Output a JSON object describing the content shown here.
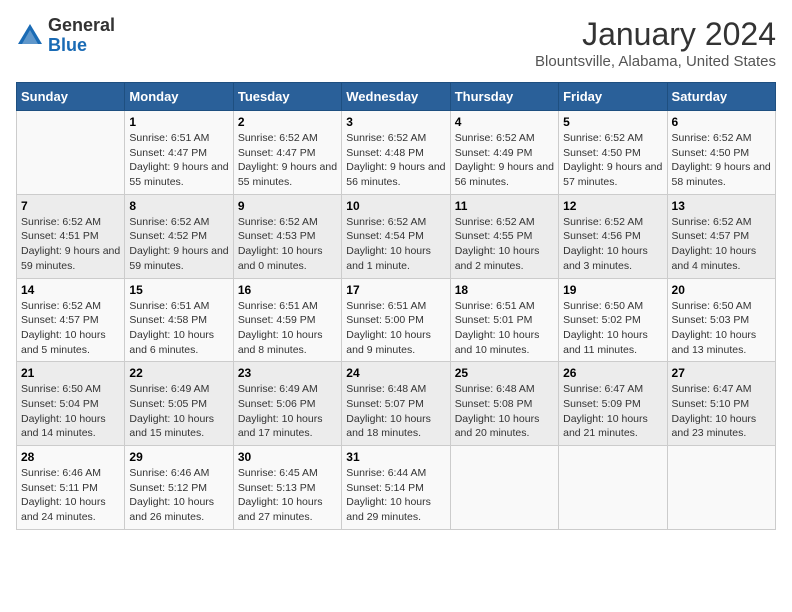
{
  "logo": {
    "general": "General",
    "blue": "Blue"
  },
  "title": "January 2024",
  "subtitle": "Blountsville, Alabama, United States",
  "days_of_week": [
    "Sunday",
    "Monday",
    "Tuesday",
    "Wednesday",
    "Thursday",
    "Friday",
    "Saturday"
  ],
  "weeks": [
    [
      {
        "day": "",
        "sunrise": "",
        "sunset": "",
        "daylight": ""
      },
      {
        "day": "1",
        "sunrise": "Sunrise: 6:51 AM",
        "sunset": "Sunset: 4:47 PM",
        "daylight": "Daylight: 9 hours and 55 minutes."
      },
      {
        "day": "2",
        "sunrise": "Sunrise: 6:52 AM",
        "sunset": "Sunset: 4:47 PM",
        "daylight": "Daylight: 9 hours and 55 minutes."
      },
      {
        "day": "3",
        "sunrise": "Sunrise: 6:52 AM",
        "sunset": "Sunset: 4:48 PM",
        "daylight": "Daylight: 9 hours and 56 minutes."
      },
      {
        "day": "4",
        "sunrise": "Sunrise: 6:52 AM",
        "sunset": "Sunset: 4:49 PM",
        "daylight": "Daylight: 9 hours and 56 minutes."
      },
      {
        "day": "5",
        "sunrise": "Sunrise: 6:52 AM",
        "sunset": "Sunset: 4:50 PM",
        "daylight": "Daylight: 9 hours and 57 minutes."
      },
      {
        "day": "6",
        "sunrise": "Sunrise: 6:52 AM",
        "sunset": "Sunset: 4:50 PM",
        "daylight": "Daylight: 9 hours and 58 minutes."
      }
    ],
    [
      {
        "day": "7",
        "sunrise": "Sunrise: 6:52 AM",
        "sunset": "Sunset: 4:51 PM",
        "daylight": "Daylight: 9 hours and 59 minutes."
      },
      {
        "day": "8",
        "sunrise": "Sunrise: 6:52 AM",
        "sunset": "Sunset: 4:52 PM",
        "daylight": "Daylight: 9 hours and 59 minutes."
      },
      {
        "day": "9",
        "sunrise": "Sunrise: 6:52 AM",
        "sunset": "Sunset: 4:53 PM",
        "daylight": "Daylight: 10 hours and 0 minutes."
      },
      {
        "day": "10",
        "sunrise": "Sunrise: 6:52 AM",
        "sunset": "Sunset: 4:54 PM",
        "daylight": "Daylight: 10 hours and 1 minute."
      },
      {
        "day": "11",
        "sunrise": "Sunrise: 6:52 AM",
        "sunset": "Sunset: 4:55 PM",
        "daylight": "Daylight: 10 hours and 2 minutes."
      },
      {
        "day": "12",
        "sunrise": "Sunrise: 6:52 AM",
        "sunset": "Sunset: 4:56 PM",
        "daylight": "Daylight: 10 hours and 3 minutes."
      },
      {
        "day": "13",
        "sunrise": "Sunrise: 6:52 AM",
        "sunset": "Sunset: 4:57 PM",
        "daylight": "Daylight: 10 hours and 4 minutes."
      }
    ],
    [
      {
        "day": "14",
        "sunrise": "Sunrise: 6:52 AM",
        "sunset": "Sunset: 4:57 PM",
        "daylight": "Daylight: 10 hours and 5 minutes."
      },
      {
        "day": "15",
        "sunrise": "Sunrise: 6:51 AM",
        "sunset": "Sunset: 4:58 PM",
        "daylight": "Daylight: 10 hours and 6 minutes."
      },
      {
        "day": "16",
        "sunrise": "Sunrise: 6:51 AM",
        "sunset": "Sunset: 4:59 PM",
        "daylight": "Daylight: 10 hours and 8 minutes."
      },
      {
        "day": "17",
        "sunrise": "Sunrise: 6:51 AM",
        "sunset": "Sunset: 5:00 PM",
        "daylight": "Daylight: 10 hours and 9 minutes."
      },
      {
        "day": "18",
        "sunrise": "Sunrise: 6:51 AM",
        "sunset": "Sunset: 5:01 PM",
        "daylight": "Daylight: 10 hours and 10 minutes."
      },
      {
        "day": "19",
        "sunrise": "Sunrise: 6:50 AM",
        "sunset": "Sunset: 5:02 PM",
        "daylight": "Daylight: 10 hours and 11 minutes."
      },
      {
        "day": "20",
        "sunrise": "Sunrise: 6:50 AM",
        "sunset": "Sunset: 5:03 PM",
        "daylight": "Daylight: 10 hours and 13 minutes."
      }
    ],
    [
      {
        "day": "21",
        "sunrise": "Sunrise: 6:50 AM",
        "sunset": "Sunset: 5:04 PM",
        "daylight": "Daylight: 10 hours and 14 minutes."
      },
      {
        "day": "22",
        "sunrise": "Sunrise: 6:49 AM",
        "sunset": "Sunset: 5:05 PM",
        "daylight": "Daylight: 10 hours and 15 minutes."
      },
      {
        "day": "23",
        "sunrise": "Sunrise: 6:49 AM",
        "sunset": "Sunset: 5:06 PM",
        "daylight": "Daylight: 10 hours and 17 minutes."
      },
      {
        "day": "24",
        "sunrise": "Sunrise: 6:48 AM",
        "sunset": "Sunset: 5:07 PM",
        "daylight": "Daylight: 10 hours and 18 minutes."
      },
      {
        "day": "25",
        "sunrise": "Sunrise: 6:48 AM",
        "sunset": "Sunset: 5:08 PM",
        "daylight": "Daylight: 10 hours and 20 minutes."
      },
      {
        "day": "26",
        "sunrise": "Sunrise: 6:47 AM",
        "sunset": "Sunset: 5:09 PM",
        "daylight": "Daylight: 10 hours and 21 minutes."
      },
      {
        "day": "27",
        "sunrise": "Sunrise: 6:47 AM",
        "sunset": "Sunset: 5:10 PM",
        "daylight": "Daylight: 10 hours and 23 minutes."
      }
    ],
    [
      {
        "day": "28",
        "sunrise": "Sunrise: 6:46 AM",
        "sunset": "Sunset: 5:11 PM",
        "daylight": "Daylight: 10 hours and 24 minutes."
      },
      {
        "day": "29",
        "sunrise": "Sunrise: 6:46 AM",
        "sunset": "Sunset: 5:12 PM",
        "daylight": "Daylight: 10 hours and 26 minutes."
      },
      {
        "day": "30",
        "sunrise": "Sunrise: 6:45 AM",
        "sunset": "Sunset: 5:13 PM",
        "daylight": "Daylight: 10 hours and 27 minutes."
      },
      {
        "day": "31",
        "sunrise": "Sunrise: 6:44 AM",
        "sunset": "Sunset: 5:14 PM",
        "daylight": "Daylight: 10 hours and 29 minutes."
      },
      {
        "day": "",
        "sunrise": "",
        "sunset": "",
        "daylight": ""
      },
      {
        "day": "",
        "sunrise": "",
        "sunset": "",
        "daylight": ""
      },
      {
        "day": "",
        "sunrise": "",
        "sunset": "",
        "daylight": ""
      }
    ]
  ]
}
